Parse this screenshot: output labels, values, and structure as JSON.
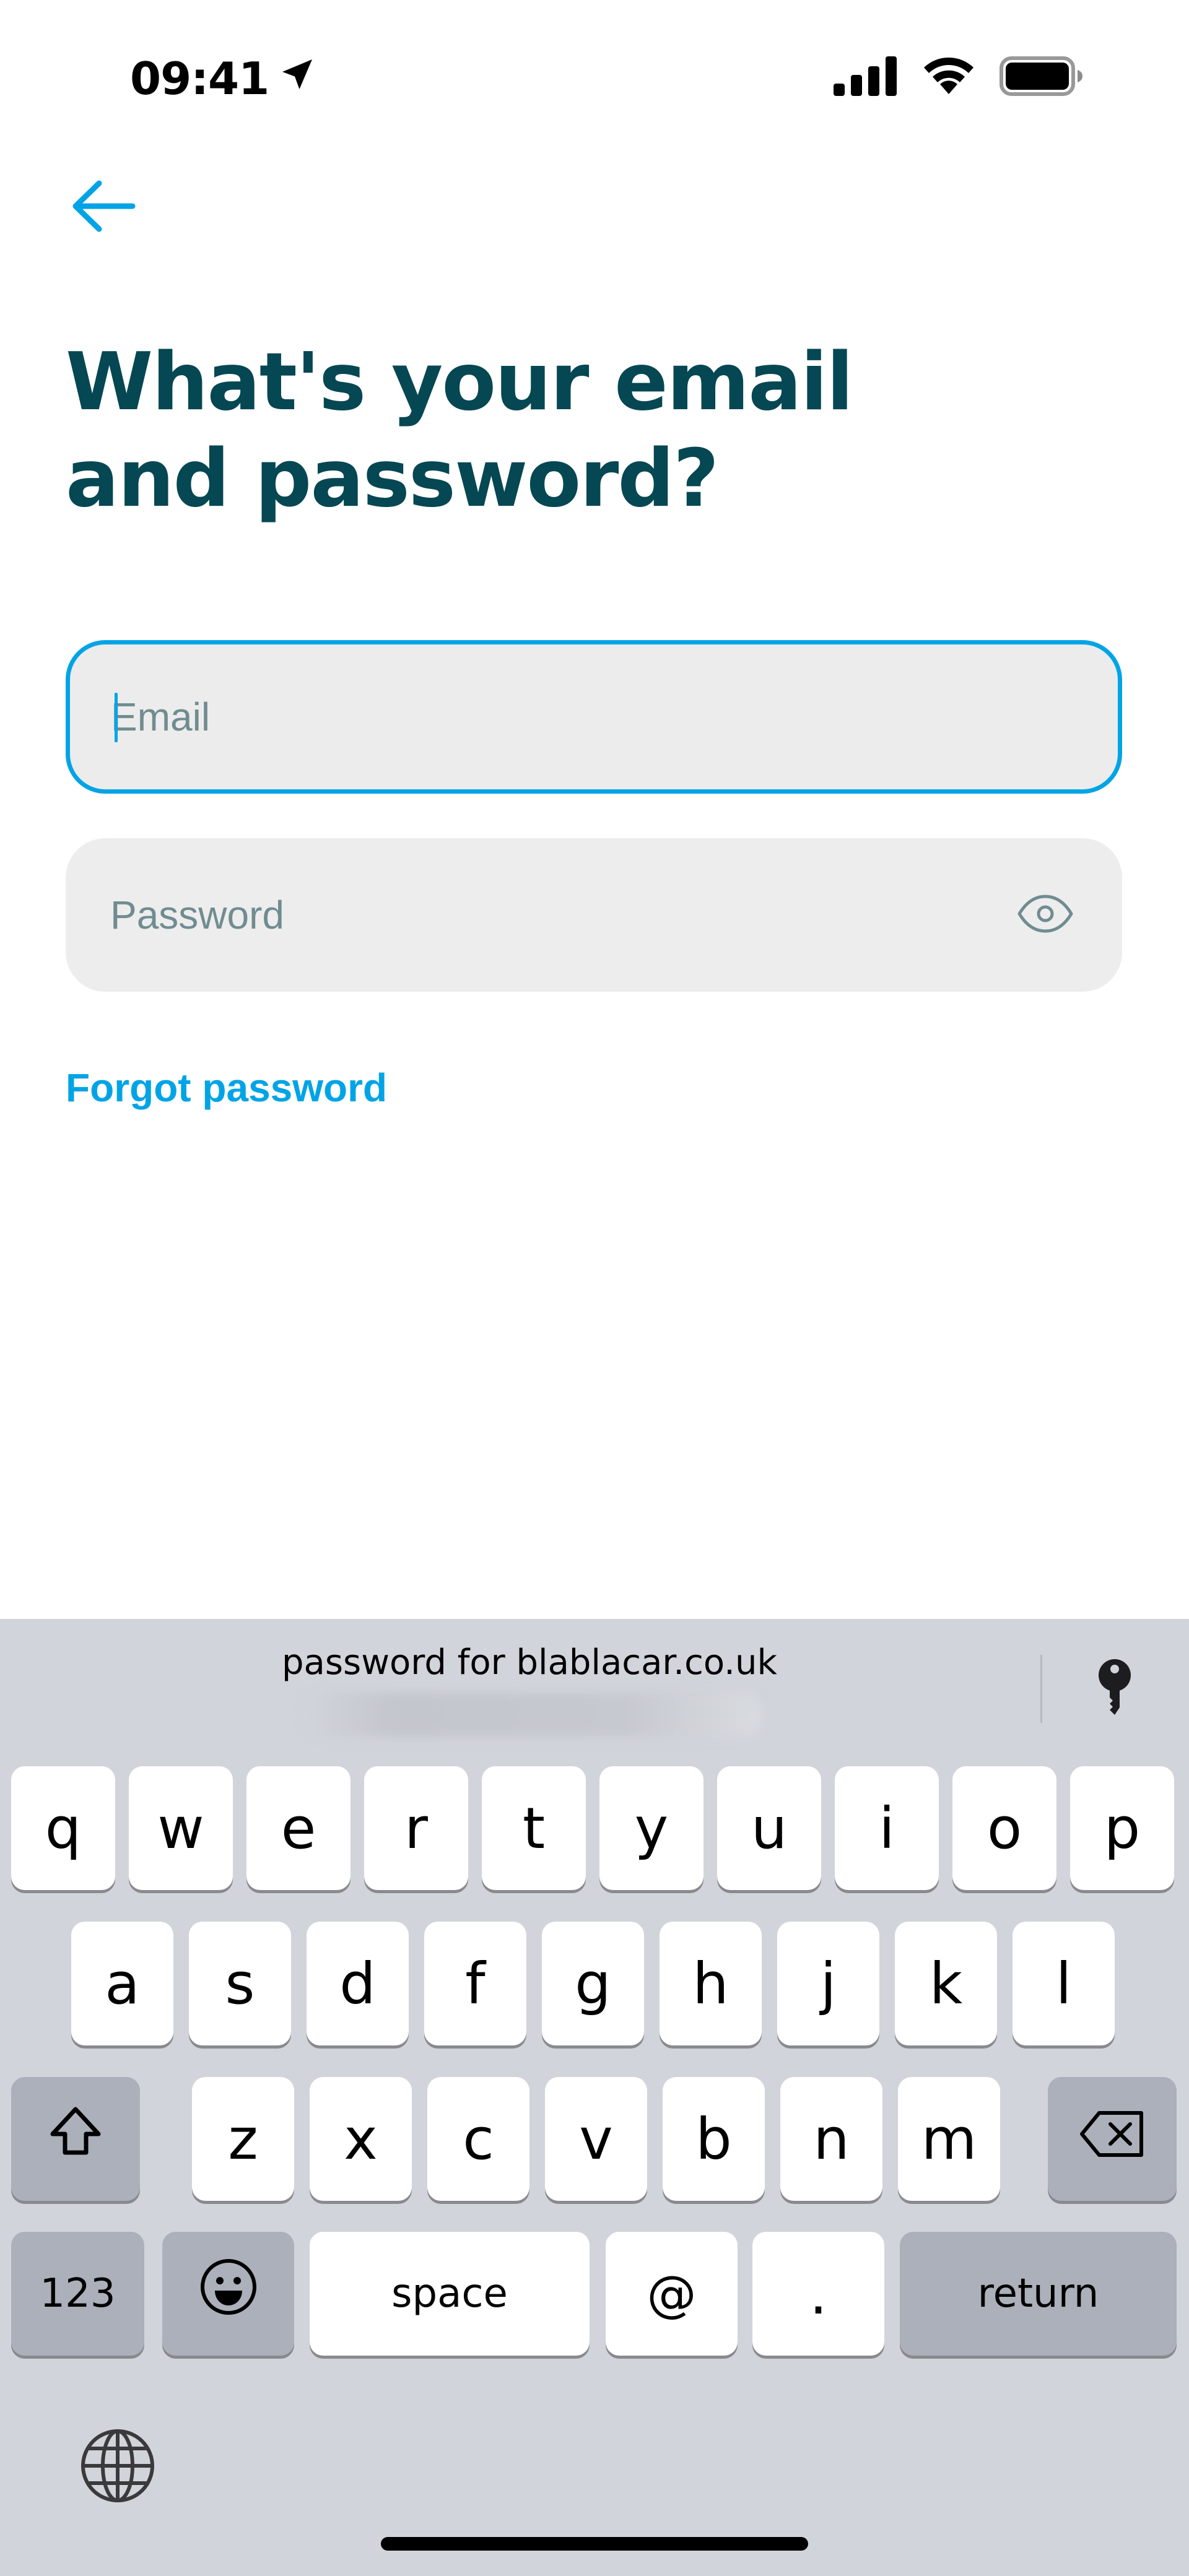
{
  "status_bar": {
    "time": "09:41"
  },
  "header": {
    "title_line1": "What's your email",
    "title_line2": "and password?"
  },
  "form": {
    "email_placeholder": "Email",
    "email_value": "",
    "password_placeholder": "Password",
    "password_value": "",
    "forgot_label": "Forgot password"
  },
  "keyboard": {
    "suggestion": "password for blablacar.co.uk",
    "row1": [
      "q",
      "w",
      "e",
      "r",
      "t",
      "y",
      "u",
      "i",
      "o",
      "p"
    ],
    "row2": [
      "a",
      "s",
      "d",
      "f",
      "g",
      "h",
      "j",
      "k",
      "l"
    ],
    "row3": [
      "z",
      "x",
      "c",
      "v",
      "b",
      "n",
      "m"
    ],
    "numbers_label": "123",
    "space_label": "space",
    "at_label": "@",
    "dot_label": ".",
    "return_label": "return"
  },
  "icons": [
    "back-arrow-icon",
    "location-arrow-icon",
    "signal-icon",
    "wifi-icon",
    "battery-icon",
    "eye-icon",
    "key-icon",
    "shift-icon",
    "delete-icon",
    "emoji-icon",
    "globe-icon"
  ],
  "colors": {
    "accent": "#00a4e6",
    "title": "#054752",
    "field_bg": "#ededed",
    "keyboard_bg": "#d1d4da",
    "fn_key": "#abb0ba"
  }
}
